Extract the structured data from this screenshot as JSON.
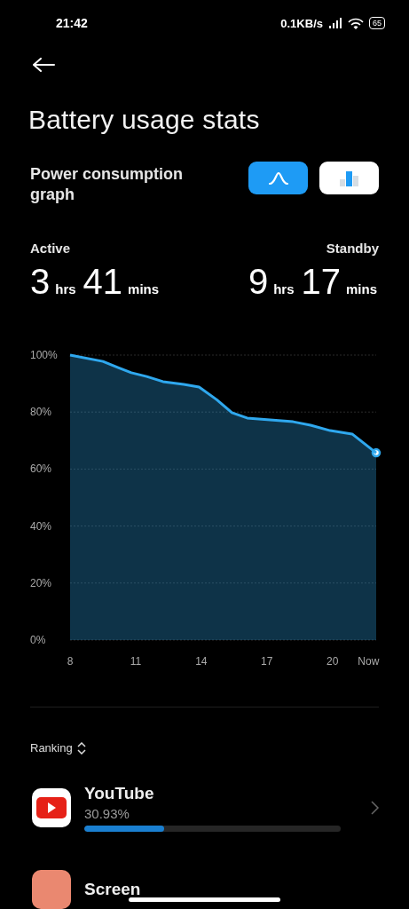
{
  "status_bar": {
    "time": "21:42",
    "network_speed": "0.1KB/s",
    "battery": "65"
  },
  "header": {
    "title": "Battery usage stats"
  },
  "graph_section": {
    "title": "Power consumption graph",
    "view_toggle": [
      {
        "kind": "curve",
        "selected": true
      },
      {
        "kind": "bars",
        "selected": false
      }
    ]
  },
  "summary": [
    {
      "label": "Active",
      "hours": "3",
      "hours_unit": "hrs",
      "minutes": "41",
      "minutes_unit": "mins"
    },
    {
      "label": "Standby",
      "hours": "9",
      "hours_unit": "hrs",
      "minutes": "17",
      "minutes_unit": "mins"
    }
  ],
  "chart_data": {
    "type": "area",
    "x": [
      8,
      9.5,
      10.2,
      10.8,
      11.5,
      12.25,
      13.2,
      13.9,
      14.7,
      15.4,
      16.1,
      18.2,
      19,
      19.9,
      20.9,
      22
    ],
    "grid": true,
    "series": [
      {
        "color": "#2fa8ee",
        "values": [
          100,
          97.8,
          95.6,
          93.8,
          92.5,
          90.7,
          89.7,
          88.8,
          84.4,
          79.8,
          77.9,
          76.6,
          75.4,
          73.5,
          72.3,
          65.7
        ]
      }
    ],
    "xlim": [
      8,
      22
    ],
    "ylim": [
      0,
      100
    ],
    "xticks": [
      8,
      11,
      14,
      17,
      20,
      {
        "value": 21.65,
        "label": "Now"
      }
    ],
    "yticks": [
      {
        "value": 0,
        "label": "0%"
      },
      {
        "value": 20,
        "label": "20%"
      },
      {
        "value": 40,
        "label": "40%"
      },
      {
        "value": 60,
        "label": "60%"
      },
      {
        "value": 80,
        "label": "80%"
      },
      {
        "value": 100,
        "label": "100%"
      }
    ]
  },
  "ranking": {
    "label": "Ranking",
    "apps": [
      {
        "kind": "youtube",
        "name": "YouTube",
        "share": "30.93%",
        "level": 0.31
      },
      {
        "kind": "screen",
        "name": "Screen"
      }
    ]
  }
}
